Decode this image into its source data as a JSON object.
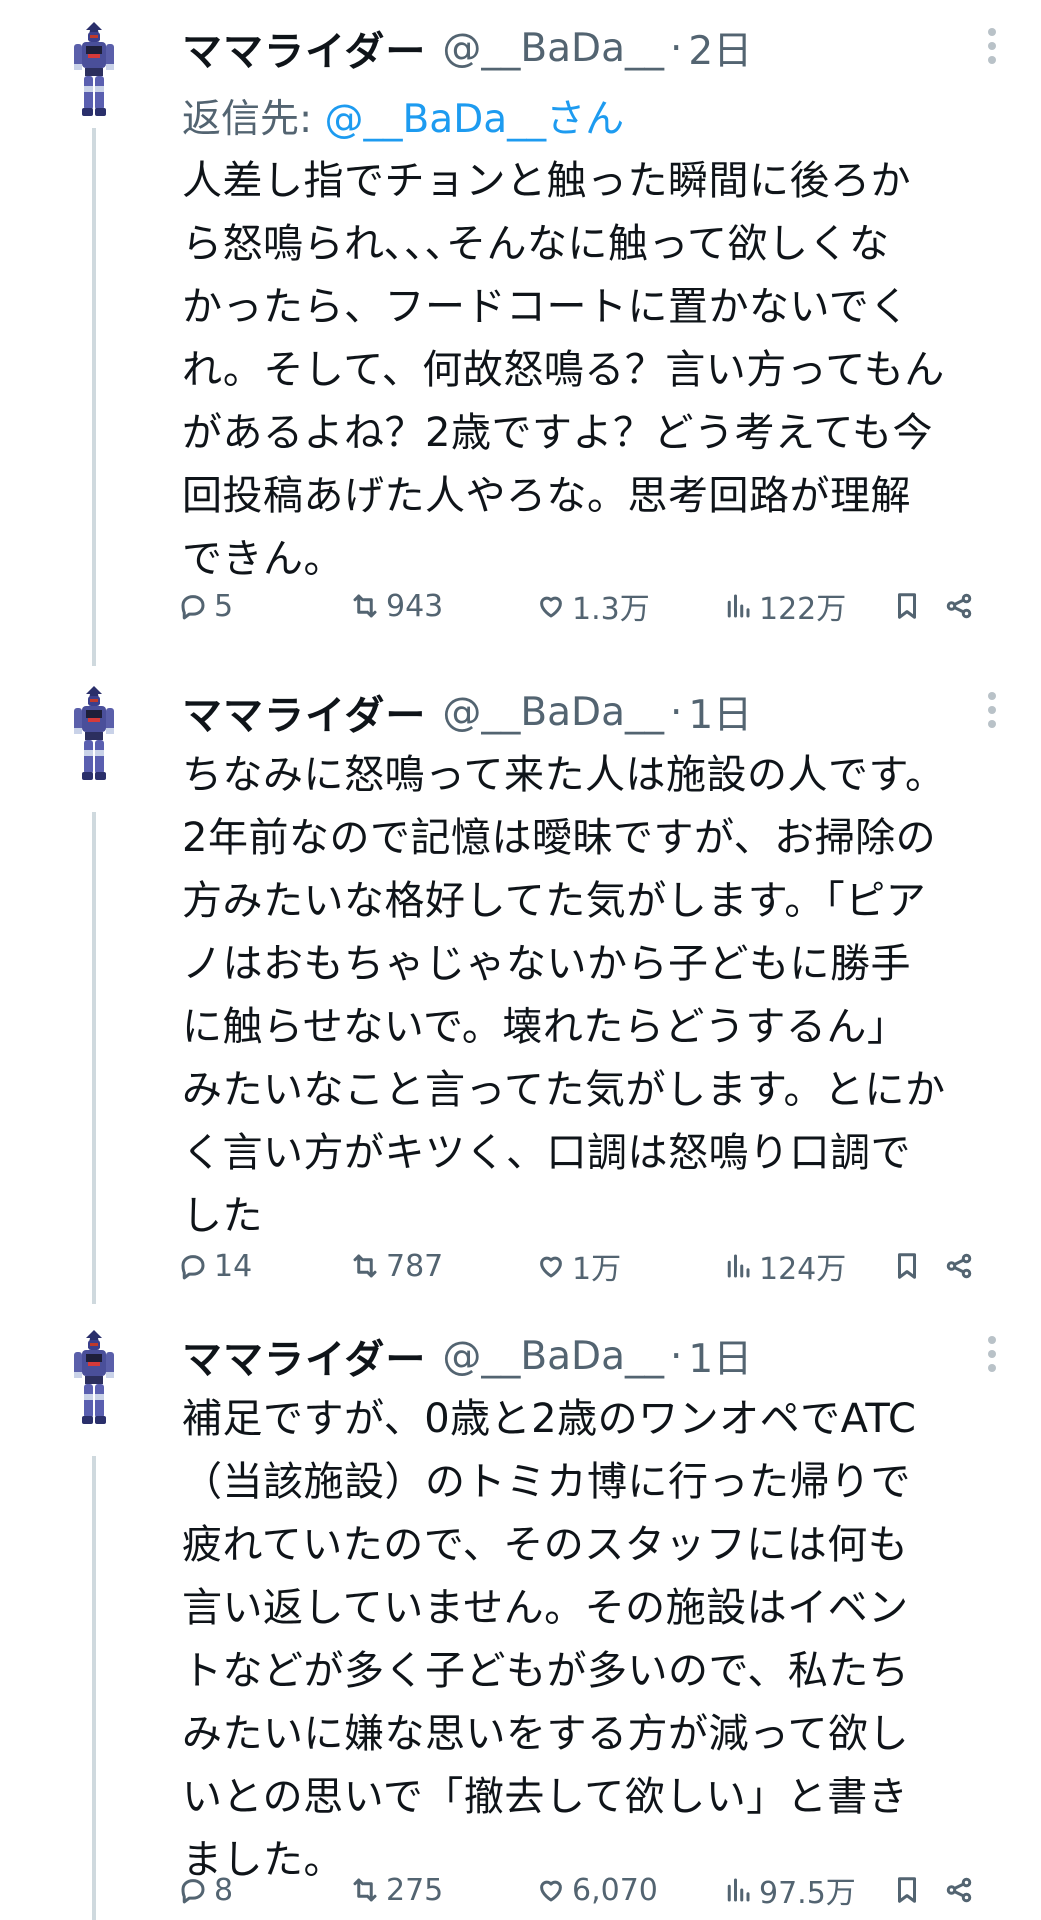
{
  "tweets": [
    {
      "name": "ママライダー",
      "handle": "@__BaDa__",
      "time": "2日",
      "reply_label": "返信先:",
      "reply_mention": "@__BaDa__さん",
      "lines": [
        "人差し指でチョンと触った瞬間に後ろか",
        "ら怒鳴られ､､､そんなに触って欲しくな",
        "かったら、フードコートに置かないでく",
        "れ。そして、何故怒鳴る？言い方ってもん",
        "があるよね？2歳ですよ？どう考えても今",
        "回投稿あげた人やろな。思考回路が理解",
        "できん。"
      ],
      "replies": "5",
      "reposts": "943",
      "likes": "1.3万",
      "views": "122万"
    },
    {
      "name": "ママライダー",
      "handle": "@__BaDa__",
      "time": "1日",
      "lines": [
        "ちなみに怒鳴って来た人は施設の人です。",
        "2年前なので記憶は曖昧ですが、お掃除の",
        "方みたいな格好してた気がします。「ピア",
        "ノはおもちゃじゃないから子どもに勝手",
        "に触らせないで。壊れたらどうするん」",
        "みたいなこと言ってた気がします。とにか",
        "く言い方がキツく、口調は怒鳴り口調で",
        "した"
      ],
      "replies": "14",
      "reposts": "787",
      "likes": "1万",
      "views": "124万"
    },
    {
      "name": "ママライダー",
      "handle": "@__BaDa__",
      "time": "1日",
      "lines": [
        "補足ですが、0歳と2歳のワンオペでATC",
        "（当該施設）のトミカ博に行った帰りで",
        "疲れていたので、そのスタッフには何も",
        "言い返していません。その施設はイベン",
        "トなどが多く子どもが多いので、私たち",
        "みたいに嫌な思いをする方が減って欲し",
        "いとの思いで「撤去して欲しい」と書き",
        "ました。"
      ],
      "replies": "8",
      "reposts": "275",
      "likes": "6,070",
      "views": "97.5万"
    }
  ],
  "icons": {
    "reply": "reply-icon",
    "repost": "repost-icon",
    "like": "heart-icon",
    "views": "views-icon",
    "bookmark": "bookmark-icon",
    "share": "share-icon",
    "more": "more-icon"
  },
  "colors": {
    "text": "#0f1419",
    "secondary": "#536471",
    "link": "#1d9bf0",
    "thread_line": "#cfd9de"
  }
}
